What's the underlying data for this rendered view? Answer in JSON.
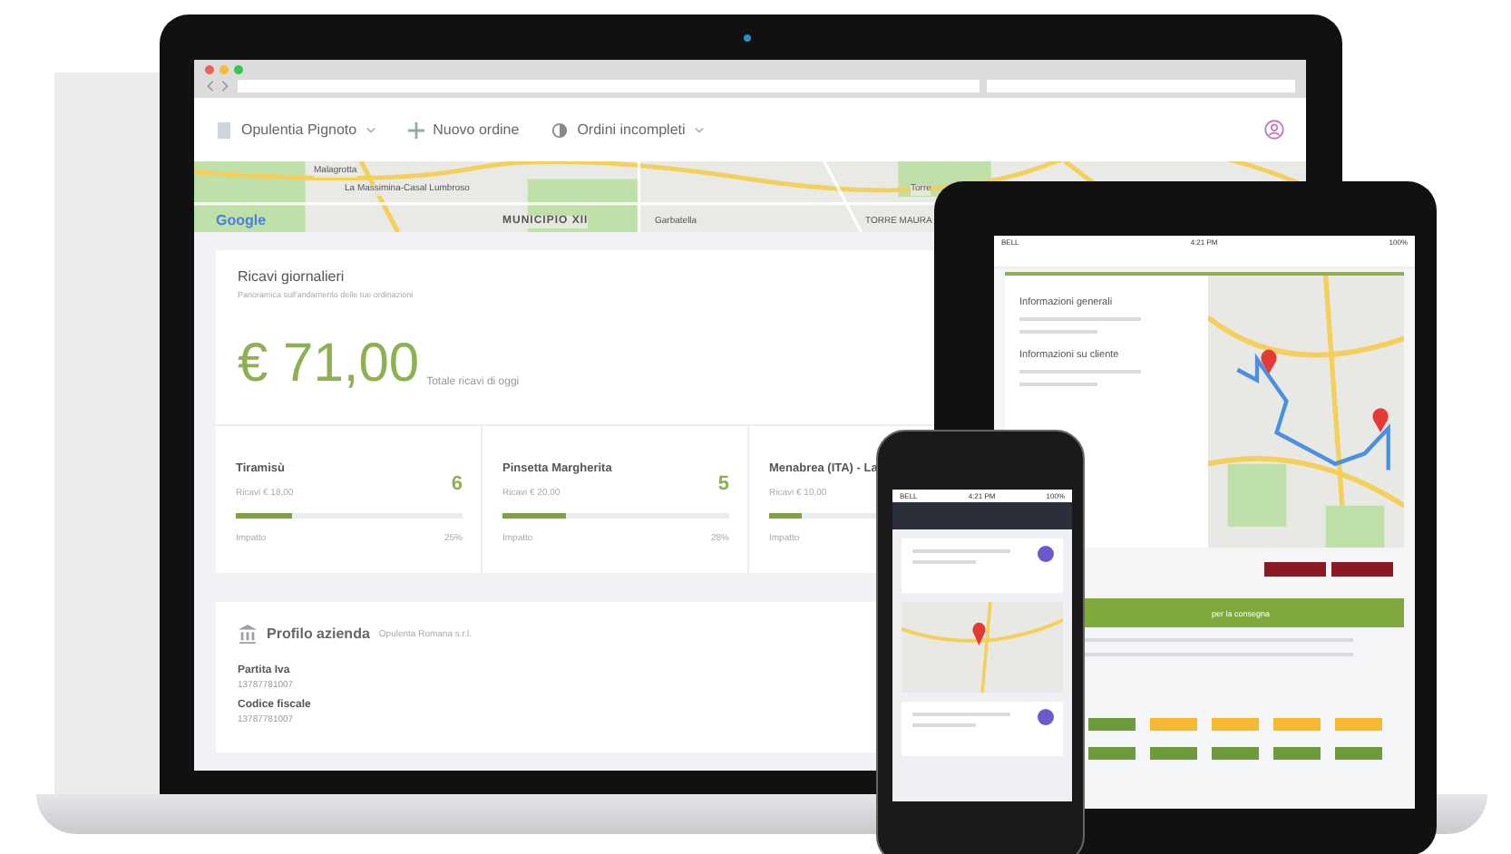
{
  "laptop": {
    "header": {
      "store": "Opulentia Pignoto",
      "new_order": "Nuovo ordine",
      "incomplete": "Ordini incompleti"
    },
    "map": {
      "labels": [
        "Malagrotta",
        "La Massimina-Casal Lumbroso",
        "Torre",
        "MUNICIPIO XII",
        "Garbatella",
        "TORRE MAURA"
      ],
      "attribution": "Google"
    },
    "revenue": {
      "title": "Ricavi giornalieri",
      "subtitle": "Panoramica sull'andamento delle tue ordinazioni",
      "total": "€ 71,00",
      "total_label": "Totale ricavi di oggi"
    },
    "products": [
      {
        "name": "Tiramisù",
        "revenue": "Ricavi € 18,00",
        "count": "6",
        "level": 0.25,
        "impact_label": "Impatto",
        "impact": "25%"
      },
      {
        "name": "Pinsetta Margherita",
        "revenue": "Ricavi € 20,00",
        "count": "5",
        "level": 0.28,
        "impact_label": "Impatto",
        "impact": "28%"
      },
      {
        "name": "Menabrea (ITA) - La",
        "revenue": "Ricavi € 10,00",
        "level": 0.14,
        "impact_label": "Impatto"
      }
    ],
    "company": {
      "title": "Profilo azienda",
      "name": "Opulenta Romana s.r.l.",
      "fields": [
        {
          "label": "Partita Iva",
          "value": "13787781007"
        },
        {
          "label": "Codice fiscale",
          "value": "13787781007"
        }
      ]
    }
  },
  "tablet": {
    "status": {
      "carrier": "BELL",
      "time": "4:21 PM",
      "battery": "100%"
    },
    "sections": [
      "Informazioni generali",
      "Informazioni su cliente"
    ],
    "delivery_header": "per la consegna",
    "slots": [
      {
        "color": "#6f9a3a"
      },
      {
        "color": "#f5b82e"
      },
      {
        "color": "#f5b82e"
      },
      {
        "color": "#f5b82e"
      },
      {
        "color": "#f5b82e"
      },
      {
        "color": "#6f9a3a"
      },
      {
        "color": "#6f9a3a"
      },
      {
        "color": "#6f9a3a"
      },
      {
        "color": "#6f9a3a"
      },
      {
        "color": "#6f9a3a"
      }
    ]
  },
  "phone": {
    "status": {
      "carrier": "BELL",
      "time": "4:21 PM",
      "battery": "100%"
    }
  }
}
